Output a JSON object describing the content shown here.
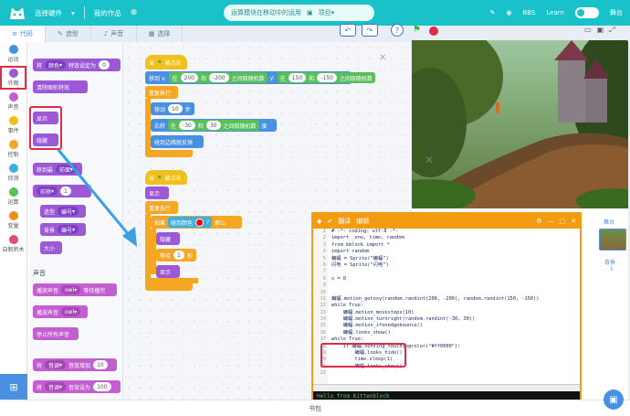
{
  "topbar": {
    "menu_hardware": "选择硬件",
    "menu_my_projects": "我的作品",
    "project_hint": "运算模块在移动中的运用",
    "project_name": "项目",
    "right_items": [
      "BBS",
      "Learn",
      "舞台"
    ]
  },
  "tabs": [
    {
      "label": "代码"
    },
    {
      "label": "造型"
    },
    {
      "label": "声音"
    },
    {
      "label": "选择"
    }
  ],
  "categories": [
    {
      "label": "运动",
      "color": "#4a90e2"
    },
    {
      "label": "外观",
      "color": "#9b59d6"
    },
    {
      "label": "声音",
      "color": "#c35ed1"
    },
    {
      "label": "事件",
      "color": "#f0c020"
    },
    {
      "label": "控制",
      "color": "#f5a623"
    },
    {
      "label": "侦测",
      "color": "#3cb0e0"
    },
    {
      "label": "运算",
      "color": "#59c059"
    },
    {
      "label": "变量",
      "color": "#f08c20"
    },
    {
      "label": "自制积木",
      "color": "#e0506a"
    }
  ],
  "palette": {
    "b_effect_label": "将",
    "b_effect_dd": "颜色",
    "b_effect_tail": "特效设定为",
    "b_effect_val": "0",
    "b_clear_effects": "清除图形特效",
    "b_show": "显示",
    "b_hide": "隐藏",
    "b_goto_label": "移到最",
    "b_goto_dd": "前面",
    "b_layer_dd": "前移",
    "b_layer_val": "1",
    "b_costume_label": "造型",
    "b_costume_dd": "编号",
    "b_backdrop_label": "背景",
    "b_backdrop_dd": "编号",
    "b_size": "大小",
    "section_sound": "声音",
    "b_play_wait": "播放声音",
    "b_play_wait_dd": "owl",
    "b_play_wait_tail": "等待播完",
    "b_play": "播放声音",
    "b_play_dd": "owl",
    "b_stop_all": "停止所有声音",
    "b_vol_change_label": "将",
    "b_vol_change_dd": "音调",
    "b_vol_change_tail": "音效增加",
    "b_vol_change_val": "10",
    "b_vol_set_label": "将",
    "b_vol_set_dd": "音调",
    "b_vol_set_tail": "音效设为",
    "b_vol_set_val": "100"
  },
  "workspace": {
    "s1_hat": "当",
    "s1_hat_tail": "被点击",
    "s1_goto_a": "移到 x:",
    "s1_goto_b": "在",
    "s1_goto_v1": "200",
    "s1_goto_c": "和",
    "s1_goto_v2": "-200",
    "s1_goto_d": "之间取随机数",
    "s1_goto_e": "y:",
    "s1_goto_f": "在",
    "s1_goto_v3": "150",
    "s1_goto_g": "和",
    "s1_goto_v4": "-150",
    "s1_goto_h": "之间取随机数",
    "s1_forever": "重复执行",
    "s1_move_a": "移动",
    "s1_move_v": "10",
    "s1_move_b": "步",
    "s1_turn_a": "右转",
    "s1_turn_b": "在",
    "s1_turn_v1": "-30",
    "s1_turn_c": "和",
    "s1_turn_v2": "30",
    "s1_turn_d": "之间取随机数",
    "s1_turn_e": "度",
    "s1_bounce": "碰到边缘就反弹",
    "s2_hat": "当",
    "s2_hat_tail": "被点击",
    "s2_show": "显示",
    "s2_forever": "重复执行",
    "s2_if_a": "如果",
    "s2_if_b": "碰到颜色",
    "s2_if_c": "?",
    "s2_if_d": "那么",
    "s2_hide": "隐藏",
    "s2_wait_a": "等待",
    "s2_wait_v": "1",
    "s2_wait_b": "秒",
    "s2_show2": "显示"
  },
  "code_window": {
    "title_btn1": "翻译",
    "title_btn2": "编辑",
    "lines": [
      "# -*- coding: utf-8 -*-",
      "import _env, time, random",
      "from kblock import *",
      "import random",
      "蝙蝠 = Sprite(\"蝙蝠\")",
      "闪电 = Sprite(\"闪电\")",
      "",
      "x = 0",
      "",
      "",
      "蝙蝠.motion_gotoxy(random.randint(200, -200), random.randint(150, -150))",
      "while True:",
      "    蝙蝠.motion_movesteps(10)",
      "    蝙蝠.motion_turnright(random.randint(-30, 30))",
      "    蝙蝠.motion_ifonedgebounce()",
      "    蝙蝠.looks_show()",
      "while True:",
      "    if 蝙蝠.sensing_touchingcolor(\"#ff0000\"):",
      "        蝙蝠.looks_hide()",
      "        time.sleep(1)",
      "        蝙蝠.looks_show()",
      ""
    ],
    "line_numbers": [
      "1",
      "2",
      "3",
      "4",
      "5",
      "6",
      "7",
      "8",
      "9",
      "10",
      "11",
      "12",
      "13",
      "14",
      "15",
      "16",
      "17",
      "18",
      "19",
      "20",
      "21",
      "22"
    ],
    "console_line1": "Hello from Kittenblock",
    "console_prompt": "$"
  },
  "sprite_panel": {
    "stage_label": "舞台",
    "backdrop_count_label": "背景",
    "backdrop_count": "1"
  },
  "bottom": {
    "label": "书包"
  }
}
